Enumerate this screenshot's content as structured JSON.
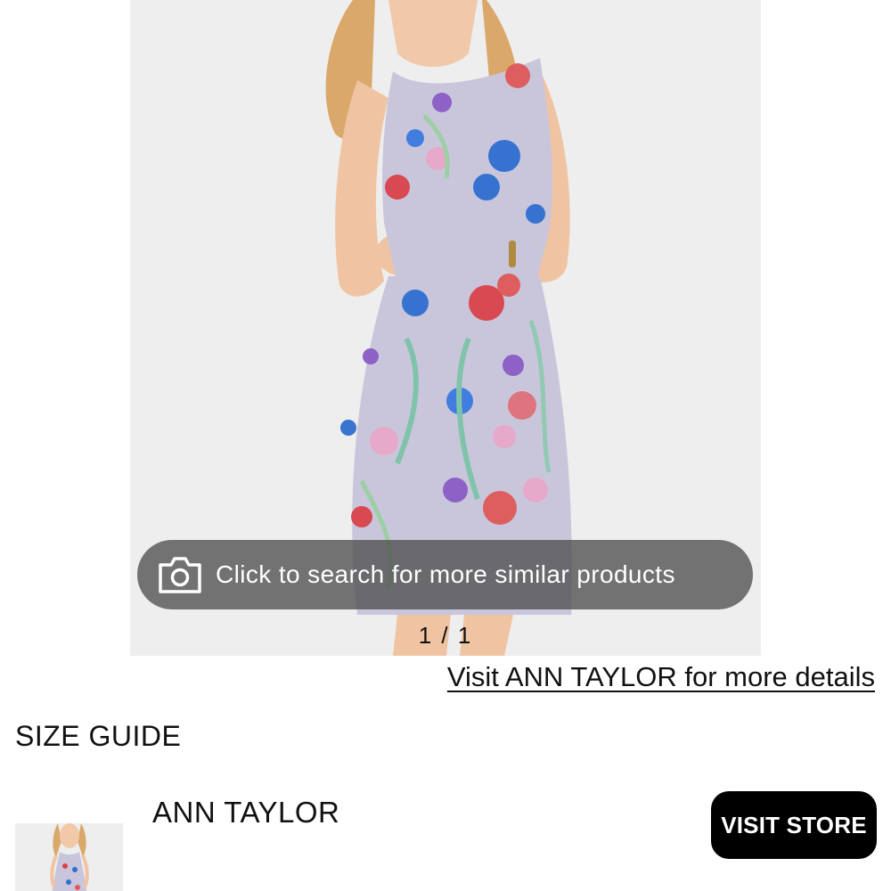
{
  "product_image": {
    "alt": "",
    "search_overlay": {
      "icon": "camera-icon",
      "label": "Click to search for more similar products"
    },
    "pager": "1 / 1"
  },
  "links": {
    "visit_details": "Visit ANN TAYLOR for more details",
    "size_guide": "SIZE GUIDE"
  },
  "store": {
    "name": "ANN TAYLOR",
    "button_label": "VISIT STORE",
    "thumbnail_icon": "product-thumbnail"
  },
  "colors": {
    "overlay_bg": "#505050",
    "button_bg": "#000000",
    "button_text": "#ffffff",
    "image_bg": "#eeeeee",
    "dress_base": "#c9c6dc"
  }
}
